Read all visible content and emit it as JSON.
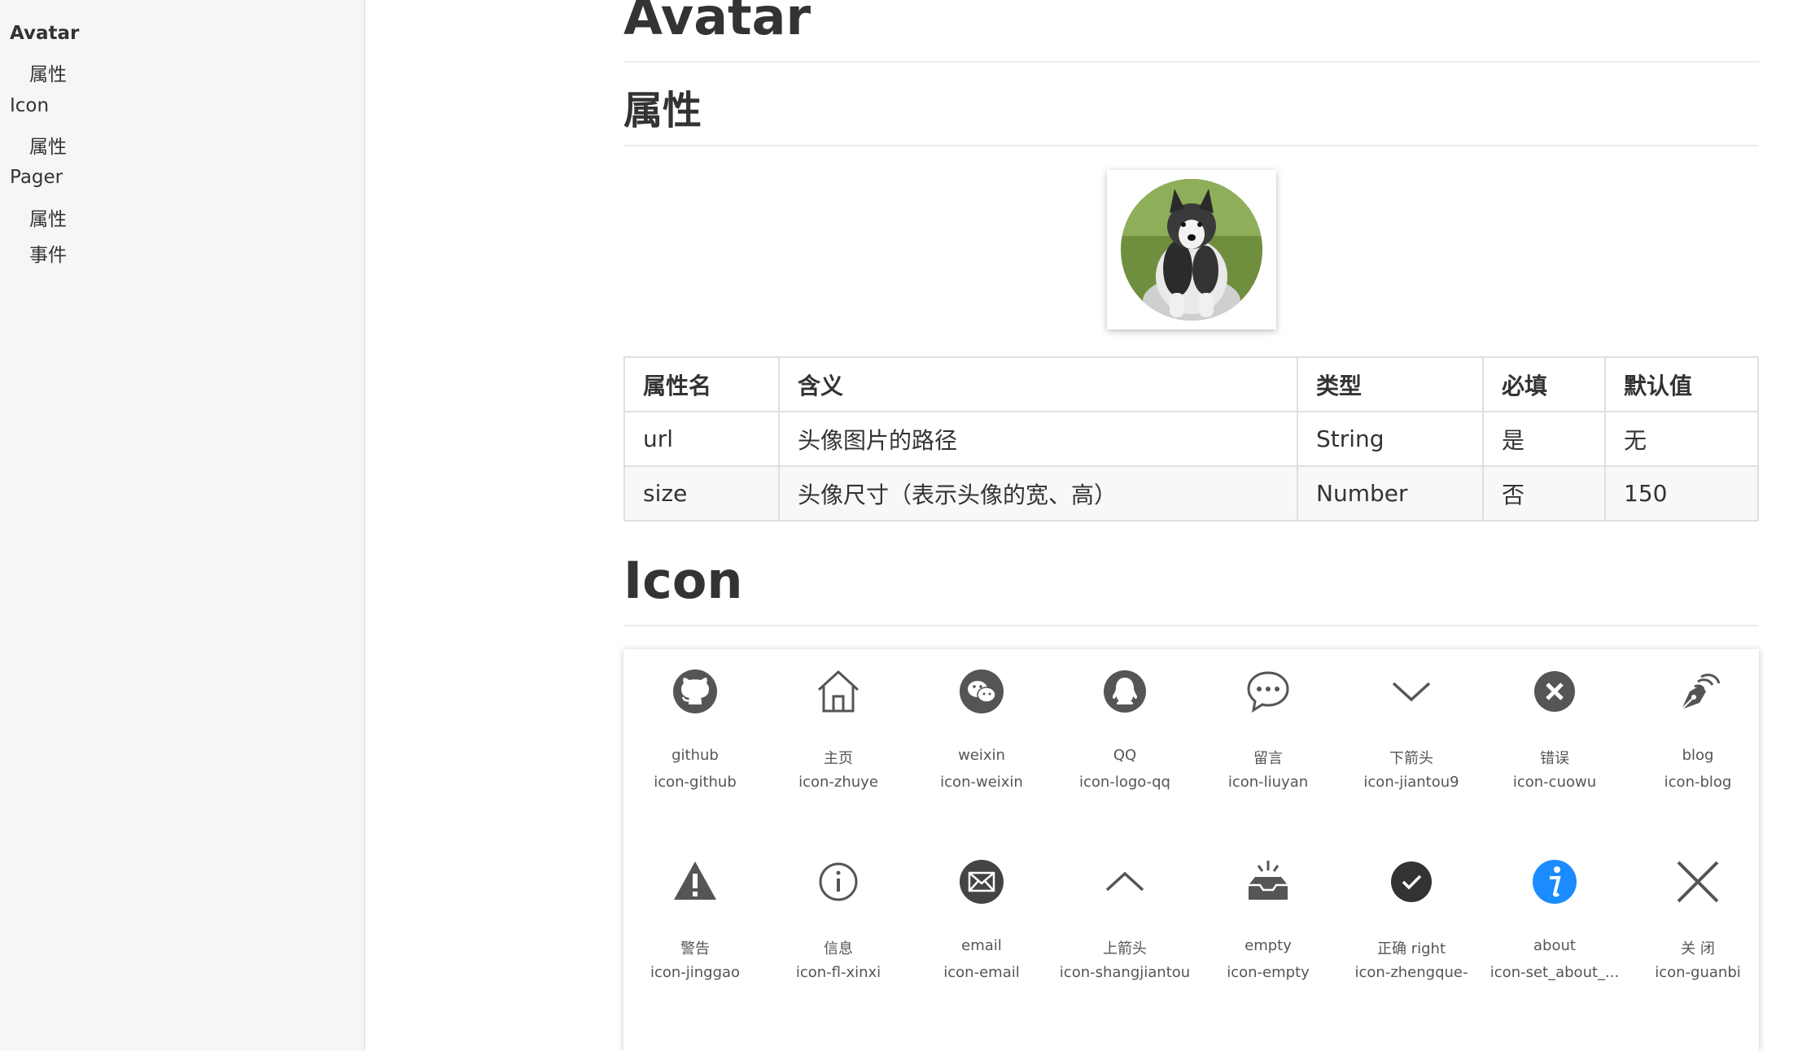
{
  "sidebar": {
    "items": [
      {
        "label": "Avatar"
      },
      {
        "label": "属性"
      },
      {
        "label": "Icon"
      },
      {
        "label": "属性"
      },
      {
        "label": "Pager"
      },
      {
        "label": "属性"
      },
      {
        "label": "事件"
      }
    ]
  },
  "avatar_section": {
    "title": "Avatar",
    "subtitle": "属性"
  },
  "props_table": {
    "headers": [
      "属性名",
      "含义",
      "类型",
      "必填",
      "默认值"
    ],
    "rows": [
      [
        "url",
        "头像图片的路径",
        "String",
        "是",
        "无"
      ],
      [
        "size",
        "头像尺寸（表示头像的宽、高）",
        "Number",
        "否",
        "150"
      ]
    ]
  },
  "icon_section": {
    "title": "Icon",
    "icons": [
      {
        "name": "github",
        "class": "icon-github",
        "glyph": "github-icon"
      },
      {
        "name": "主页",
        "class": "icon-zhuye",
        "glyph": "home-icon"
      },
      {
        "name": "weixin",
        "class": "icon-weixin",
        "glyph": "wechat-icon"
      },
      {
        "name": "QQ",
        "class": "icon-logo-qq",
        "glyph": "qq-icon"
      },
      {
        "name": "留言",
        "class": "icon-liuyan",
        "glyph": "chat-bubble-icon"
      },
      {
        "name": "下箭头",
        "class": "icon-jiantou9",
        "glyph": "chevron-down-icon"
      },
      {
        "name": "错误",
        "class": "icon-cuowu",
        "glyph": "error-circle-icon"
      },
      {
        "name": "blog",
        "class": "icon-blog",
        "glyph": "pen-nib-icon"
      },
      {
        "name": "警告",
        "class": "icon-jinggao",
        "glyph": "warning-icon"
      },
      {
        "name": "信息",
        "class": "icon-fl-xinxi",
        "glyph": "info-outline-icon"
      },
      {
        "name": "email",
        "class": "icon-email",
        "glyph": "email-icon"
      },
      {
        "name": "上箭头",
        "class": "icon-shangjiantou",
        "glyph": "chevron-up-icon"
      },
      {
        "name": "empty",
        "class": "icon-empty",
        "glyph": "empty-tray-icon"
      },
      {
        "name": "正确 right",
        "class": "icon-zhengque-",
        "glyph": "check-circle-icon"
      },
      {
        "name": "about",
        "class": "icon-set_about_...",
        "glyph": "about-info-icon"
      },
      {
        "name": "关 闭",
        "class": "icon-guanbi",
        "glyph": "close-icon"
      }
    ]
  },
  "colors": {
    "about_icon": "#1a8cff",
    "icon_dark": "#333333",
    "sidebar_bg": "#f6f6f6"
  }
}
